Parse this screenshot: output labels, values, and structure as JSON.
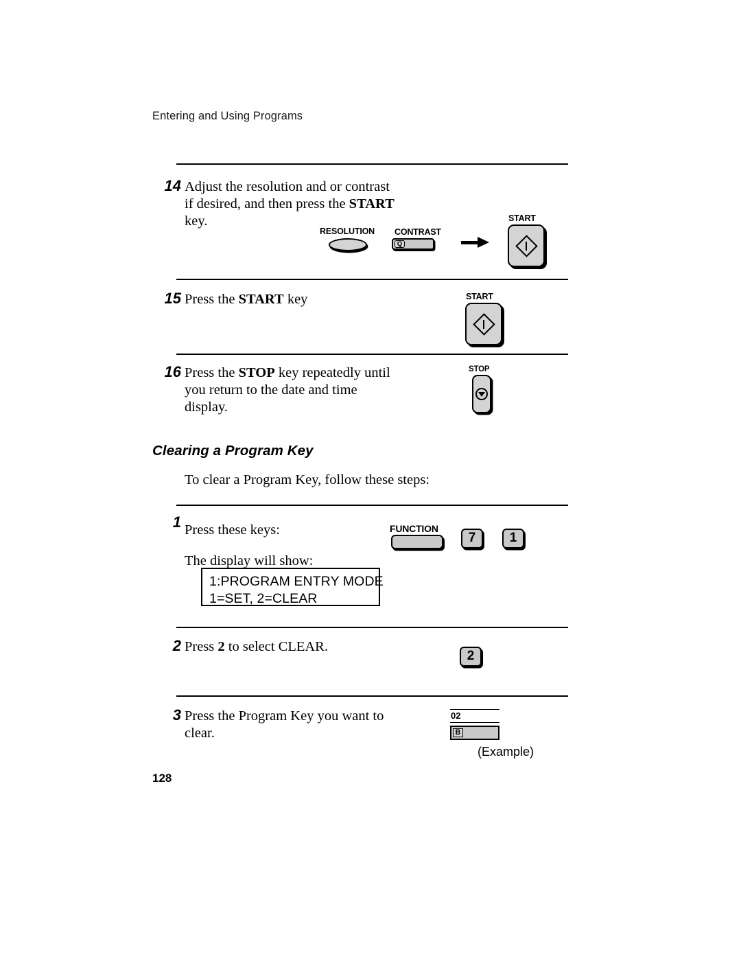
{
  "header": {
    "running_head": "Entering and Using Programs"
  },
  "steps": [
    {
      "number": "14",
      "text_parts": [
        "Adjust the resolution and or contrast if desired, and then press the ",
        "START",
        " key."
      ],
      "line1": "Adjust the resolution and or contrast",
      "line2_pre": "if desired, and then press the ",
      "line2_bold": "START",
      "line3": "key."
    },
    {
      "number": "15",
      "pre": "Press the ",
      "bold": "START",
      "post": " key"
    },
    {
      "number": "16",
      "line1_pre": "Press the ",
      "line1_bold": "STOP",
      "line1_post": " key repeatedly until",
      "line2": "you return to the date and time",
      "line3": "display."
    }
  ],
  "section": {
    "heading": "Clearing a Program Key",
    "intro": "To clear a Program Key, follow these steps:"
  },
  "clear_steps": [
    {
      "number": "1",
      "line1": "Press these keys:",
      "line2": "The display will show:"
    },
    {
      "number": "2",
      "pre": "Press ",
      "bold": "2",
      "post": " to select CLEAR."
    },
    {
      "number": "3",
      "line1": "Press the Program Key you want to",
      "line2": "clear."
    }
  ],
  "keys": {
    "resolution_label": "RESOLUTION",
    "contrast_label": "CONTRAST",
    "contrast_glyph": "Q",
    "start_label": "START",
    "stop_label": "STOP",
    "function_label": "FUNCTION",
    "num_7": "7",
    "num_1": "1",
    "num_2": "2"
  },
  "display": {
    "line1": "1:PROGRAM ENTRY MODE",
    "line2": "1=SET, 2=CLEAR"
  },
  "program_key": {
    "number": "02",
    "letter": "B",
    "caption": "(Example)"
  },
  "footer": {
    "page_number": "128"
  },
  "colors": {
    "key_face": "#d4d4d4",
    "key_face_dark": "#c9c9c9",
    "ink": "#000000",
    "paper": "#ffffff"
  }
}
